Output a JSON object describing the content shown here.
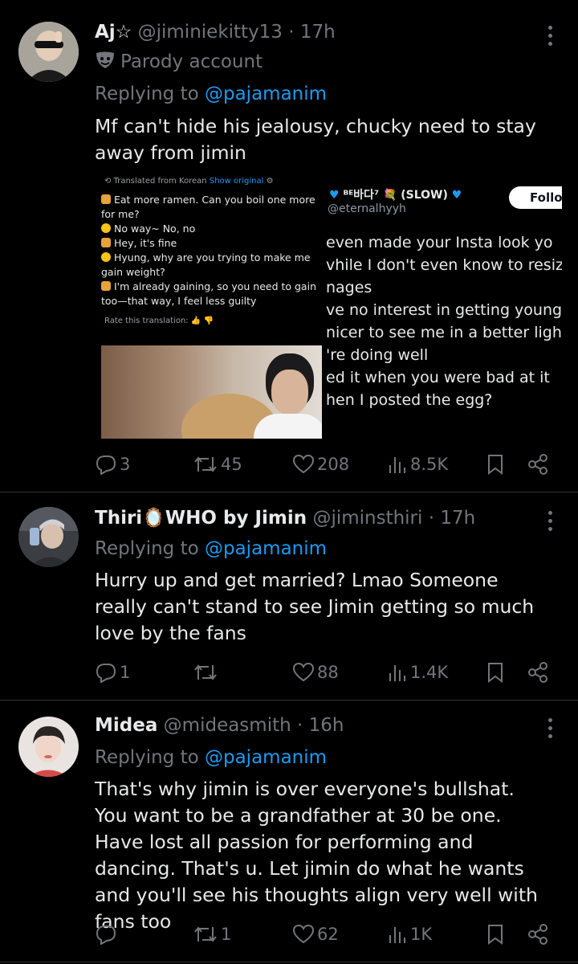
{
  "tweets": [
    {
      "name": "Aj☆",
      "handle": "@jiminiekitty13",
      "time": "17h",
      "badge": "Parody account",
      "replying_prefix": "Replying to",
      "replying_to": "@pajamanim",
      "text": "Mf can't hide his jealousy, chucky need to stay away from jimin",
      "stats": {
        "replies": "3",
        "retweets": "45",
        "likes": "208",
        "views": "8.5K"
      }
    },
    {
      "name": "Thiri🪞WHO by Jimin",
      "handle": "@jiminsthiri",
      "time": "17h",
      "replying_prefix": "Replying to",
      "replying_to": "@pajamanim",
      "text": "Hurry up and get married? Lmao Someone really can't stand to see Jimin getting so much love by the fans",
      "stats": {
        "replies": "1",
        "retweets": "",
        "likes": "88",
        "views": "1.4K"
      }
    },
    {
      "name": "Midea",
      "handle": "@mideasmith",
      "time": "16h",
      "replying_prefix": "Replying to",
      "replying_to": "@pajamanim",
      "text": "That's why jimin is over everyone's bullshat. You want to be a grandfather at 30 be one. Have lost all passion for performing and dancing. That's u. Let jimin do what he wants and you'll see his thoughts align very well with fans too",
      "stats": {
        "replies": "",
        "retweets": "1",
        "likes": "62",
        "views": "1K"
      }
    }
  ],
  "media": {
    "translated_from": "Translated from Korean",
    "show_original": "Show original",
    "translation_lines": [
      {
        "icon": "tiger",
        "text": "Eat more ramen. Can you boil one more for me?"
      },
      {
        "icon": "chick",
        "text": "No way~ No, no"
      },
      {
        "icon": "tiger",
        "text": "Hey, it's fine"
      },
      {
        "icon": "chick",
        "text": "Hyung, why are you trying to make me gain weight?"
      },
      {
        "icon": "tiger",
        "text": "I'm already gaining, so you need to gain too—that way, I feel less guilty"
      }
    ],
    "rate_translation": "Rate this translation:",
    "quote_name": "ᴮᴱ바다⁷ 💐 (SLOW)",
    "quote_handle": "@eternalhyyh",
    "follow_label": "Follo",
    "quote_lines": [
      "even made your Insta look yo",
      "vhile I don't even know to resiz",
      "nages",
      "ve no interest in getting young",
      "nicer to see me in a better ligh",
      "'re doing well",
      "ed it when you were bad at it",
      "hen I posted the egg?"
    ]
  },
  "colors": {
    "background": "#000000",
    "text": "#e7e9ea",
    "secondary": "#71767b",
    "link": "#1d9bf0",
    "divider": "#2f3336"
  }
}
